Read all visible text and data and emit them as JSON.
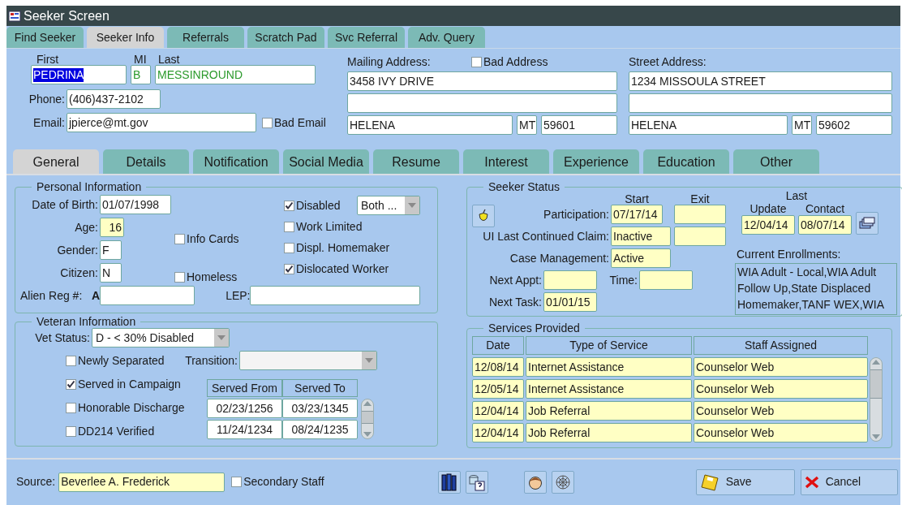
{
  "window": {
    "title": "Seeker Screen"
  },
  "top_tabs": [
    {
      "label": "Find Seeker",
      "selected": false
    },
    {
      "label": "Seeker Info",
      "selected": true
    },
    {
      "label": "Referrals",
      "selected": false
    },
    {
      "label": "Scratch Pad",
      "selected": false
    },
    {
      "label": "Svc Referral",
      "selected": false
    },
    {
      "label": "Adv. Query",
      "selected": false
    }
  ],
  "name": {
    "first_label": "First",
    "mi_label": "MI",
    "last_label": "Last",
    "first": {
      "value": "PEDRINA",
      "selected": true
    },
    "mi": "B",
    "last": "MESSINROUND"
  },
  "contact": {
    "phone_label": "Phone:",
    "phone": "(406)437-2102",
    "email_label": "Email:",
    "email": "jpierce@mt.gov",
    "bad_email": {
      "label": "Bad Email",
      "checked": false
    }
  },
  "mailing_address": {
    "label": "Mailing Address:",
    "bad_address": {
      "label": "Bad Address",
      "checked": false
    },
    "line_1": "3458 IVY DRIVE",
    "city": "HELENA",
    "state": "MT",
    "zip": "59601"
  },
  "street_address": {
    "label": "Street Address:",
    "line_1": "1234 MISSOULA STREET",
    "city": "HELENA",
    "state": "MT",
    "zip": "59602"
  },
  "section_tabs": [
    {
      "label": "General",
      "selected": true
    },
    {
      "label": "Details",
      "selected": false
    },
    {
      "label": "Notification",
      "selected": false
    },
    {
      "label": "Social Media",
      "selected": false
    },
    {
      "label": "Resume",
      "selected": false
    },
    {
      "label": "Interest",
      "selected": false
    },
    {
      "label": "Experience",
      "selected": false
    },
    {
      "label": "Education",
      "selected": false
    },
    {
      "label": "Other",
      "selected": false
    }
  ],
  "personal_information": {
    "title": "Personal Information",
    "date_of_birth_label": "Date of Birth:",
    "date_of_birth": "01/07/1998",
    "age_label": "Age:",
    "age": "16",
    "gender_label": "Gender:",
    "gender": "F",
    "citizen_label": "Citizen:",
    "citizen": "N",
    "alien_reg_label": "Alien Reg #:",
    "alien_reg_prefix": "A",
    "lep_label": "LEP:",
    "disabled_type": "Both ...",
    "checkboxes_middle": [
      {
        "label": "Info Cards",
        "checked": false
      },
      {
        "label": "Homeless",
        "checked": false
      }
    ],
    "checkboxes_right": [
      {
        "label": "Disabled",
        "checked": true
      },
      {
        "label": "Work Limited",
        "checked": false
      },
      {
        "label": "Displ. Homemaker",
        "checked": false
      },
      {
        "label": "Dislocated Worker",
        "checked": true
      }
    ]
  },
  "seeker_status": {
    "title": "Seeker Status",
    "start_label": "Start",
    "exit_label": "Exit",
    "last_label": "Last",
    "update_label": "Update",
    "contact_label": "Contact",
    "participation_label": "Participation:",
    "participation_start": "07/17/14",
    "ui_claim_label": "UI Last Continued Claim:",
    "ui_claim": "Inactive",
    "last_update": "12/04/14",
    "last_contact": "08/07/14",
    "case_management_label": "Case Management:",
    "case_management": "Active",
    "next_appt_label": "Next Appt:",
    "time_label": "Time:",
    "next_task_label": "Next Task:",
    "next_task": "01/01/15",
    "enrollments_label": "Current Enrollments:",
    "enrollments": "WIA Adult - Local,WIA Adult Follow Up,State Displaced Homemaker,TANF WEX,WIA"
  },
  "veteran_information": {
    "title": "Veteran Information",
    "vet_status_label": "Vet Status:",
    "vet_status": "D - < 30% Disabled",
    "transition_label": "Transition:",
    "checkboxes": [
      {
        "label": "Newly Separated",
        "checked": false
      },
      {
        "label": "Served in Campaign",
        "checked": true
      },
      {
        "label": "Honorable Discharge",
        "checked": false
      },
      {
        "label": "DD214 Verified",
        "checked": false
      }
    ],
    "served": {
      "columns": [
        "Served From",
        "Served To"
      ],
      "rows": [
        [
          "02/23/1256",
          "03/23/1345"
        ],
        [
          "11/24/1234",
          "08/24/1235"
        ]
      ]
    }
  },
  "services_provided": {
    "title": "Services Provided",
    "columns": [
      "Date",
      "Type of Service",
      "Staff Assigned"
    ],
    "rows": [
      [
        "12/08/14",
        "Internet Assistance",
        "Counselor Web"
      ],
      [
        "12/05/14",
        "Internet Assistance",
        "Counselor Web"
      ],
      [
        "12/04/14",
        "Job Referral",
        "Counselor Web"
      ],
      [
        "12/04/14",
        "Job Referral",
        "Counselor Web"
      ]
    ]
  },
  "footer": {
    "source_label": "Source:",
    "source": "Beverlee A. Frederick",
    "secondary_staff": {
      "label": "Secondary Staff",
      "checked": false
    },
    "save": "Save",
    "cancel": "Cancel"
  }
}
